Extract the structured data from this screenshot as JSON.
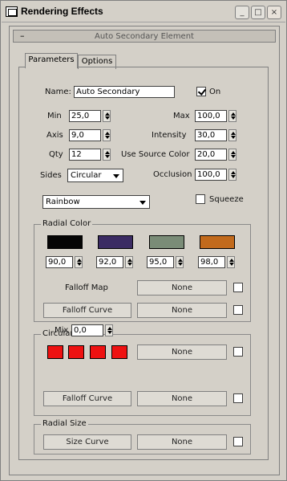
{
  "window": {
    "title": "Rendering Effects"
  },
  "title_buttons": {
    "minimize": "_",
    "maximize": "□",
    "close": "×"
  },
  "rollout": {
    "toggle": "–",
    "title": "Auto Secondary Element"
  },
  "tabs": [
    "Parameters",
    "Options"
  ],
  "params": {
    "name_label": "Name:",
    "name_value": "Auto Secondary",
    "on_label": "On",
    "on_checked": true,
    "min_label": "Min",
    "min_value": "25,0",
    "max_label": "Max",
    "max_value": "100,0",
    "axis_label": "Axis",
    "axis_value": "9,0",
    "intensity_label": "Intensity",
    "intensity_value": "30,0",
    "qty_label": "Qty",
    "qty_value": "12",
    "use_source_label": "Use Source Color",
    "use_source_value": "20,0",
    "sides_label": "Sides",
    "sides_value": "Circular",
    "occlusion_label": "Occlusion",
    "occlusion_value": "100,0",
    "preset_value": "Rainbow",
    "squeeze_label": "Squeeze"
  },
  "radial_color": {
    "title": "Radial Color",
    "swatches": [
      {
        "color": "#050505",
        "value": "90,0"
      },
      {
        "color": "#3b2b63",
        "value": "92,0"
      },
      {
        "color": "#7a8c77",
        "value": "95,0"
      },
      {
        "color": "#c26a1c",
        "value": "98,0"
      }
    ],
    "falloff_map_label": "Falloff Map",
    "falloff_curve_label": "Falloff Curve",
    "none_label": "None"
  },
  "circular_color": {
    "title": "Circular Color",
    "mix_label": "Mix",
    "mix_value": "0,0",
    "swatch_color": "#ee1111",
    "falloff_curve_label": "Falloff Curve",
    "none_label": "None"
  },
  "radial_size": {
    "title": "Radial Size",
    "size_curve_label": "Size Curve",
    "none_label": "None"
  }
}
